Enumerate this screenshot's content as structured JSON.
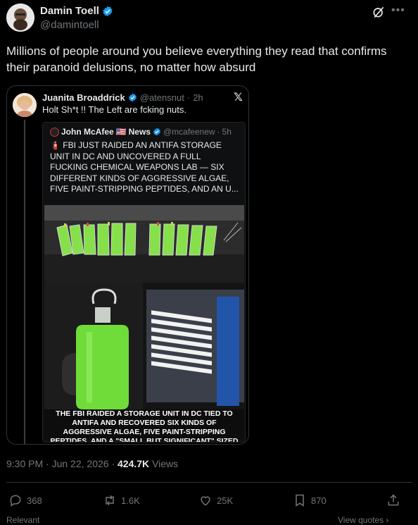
{
  "author": {
    "name": "Damin Toell",
    "handle": "@damintoell"
  },
  "tweet": {
    "text": "Millions of people around you believe everything they read that confirms their paranoid delusions, no matter how absurd"
  },
  "quote": {
    "name": "Juanita Broaddrick",
    "handle": "@atensnut",
    "time": "2h",
    "text": "Holt Sh*t !!   The Left are fcking nuts.",
    "inner": {
      "name": "John McAfee",
      "flag": "🇺🇸",
      "name_suffix": "News",
      "handle": "@mcafeenew",
      "time": "5h",
      "siren": "🧯",
      "text": "FBI JUST RAIDED AN ANTIFA STORAGE UNIT IN DC AND UNCOVERED A FULL FUCKING CHEMICAL WEAPONS LAB — SIX DIFFERENT KINDS OF AGGRESSIVE ALGAE, FIVE PAINT-STRIPPING PEPTIDES, AND AN U...",
      "image_caption": "THE FBI RAIDED A STORAGE UNIT IN DC TIED TO ANTIFA AND RECOVERED SIX KINDS OF AGGRESSIVE ALGAE, FIVE PAINT-STRIPPING PEPTIDES, AND A \"SMALL BUT SIGNIFICANT\" SIZED ULTRASONIC GROW LAB"
    }
  },
  "meta": {
    "time": "9:30 PM",
    "date": "Jun 22, 2026",
    "views_count": "424.7K",
    "views_label": "Views"
  },
  "actions": {
    "replies": "368",
    "reposts": "1.6K",
    "likes": "25K",
    "bookmarks": "870"
  },
  "footer": {
    "relevant": "Relevant",
    "view_quotes": "View quotes"
  },
  "colors": {
    "accent": "#1d9bf0",
    "muted": "#71767b",
    "border": "#2f3336",
    "algae": "#7ad63a"
  }
}
